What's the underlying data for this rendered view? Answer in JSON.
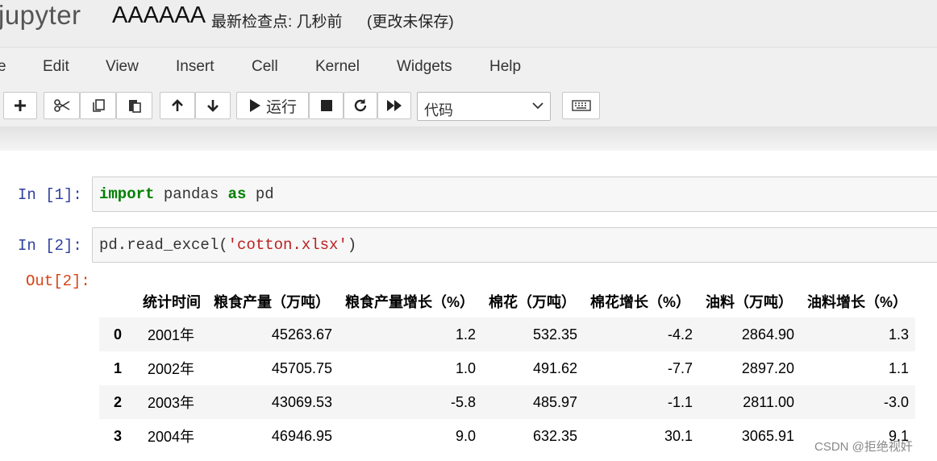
{
  "header": {
    "logo_text": "jupyter",
    "notebook_name": "AAAAAA",
    "checkpoint": "最新检查点: 几秒前",
    "autosave_status": "(更改未保存)"
  },
  "menu": [
    "e",
    "Edit",
    "View",
    "Insert",
    "Cell",
    "Kernel",
    "Widgets",
    "Help"
  ],
  "toolbar": {
    "run_label": "运行",
    "cell_type": "代码",
    "icons": [
      "plus-icon",
      "cut-icon",
      "copy-icon",
      "paste-icon",
      "arrow-up-icon",
      "arrow-down-icon",
      "play-icon",
      "stop-icon",
      "restart-icon",
      "fast-forward-icon",
      "keyboard-icon"
    ]
  },
  "cells": [
    {
      "prompt": "In  [1]:",
      "code": {
        "kw1": "import",
        "t1": " pandas ",
        "kw2": "as",
        "t2": " pd"
      }
    },
    {
      "prompt": "In  [2]:",
      "code": {
        "t1": "pd.read_excel(",
        "str": "'cotton.xlsx'",
        "t2": ")"
      },
      "out_prompt": "Out[2]:"
    }
  ],
  "table": {
    "columns": [
      "统计时间",
      "粮食产量（万吨）",
      "粮食产量增长（%）",
      "棉花（万吨）",
      "棉花增长（%）",
      "油料（万吨）",
      "油料增长（%）"
    ],
    "rows": [
      [
        "0",
        "2001年",
        "45263.67",
        "1.2",
        "532.35",
        "-4.2",
        "2864.90",
        "1.3"
      ],
      [
        "1",
        "2002年",
        "45705.75",
        "1.0",
        "491.62",
        "-7.7",
        "2897.20",
        "1.1"
      ],
      [
        "2",
        "2003年",
        "43069.53",
        "-5.8",
        "485.97",
        "-1.1",
        "2811.00",
        "-3.0"
      ],
      [
        "3",
        "2004年",
        "46946.95",
        "9.0",
        "632.35",
        "30.1",
        "3065.91",
        "9.1"
      ]
    ]
  },
  "watermark": "CSDN @拒绝视奸"
}
